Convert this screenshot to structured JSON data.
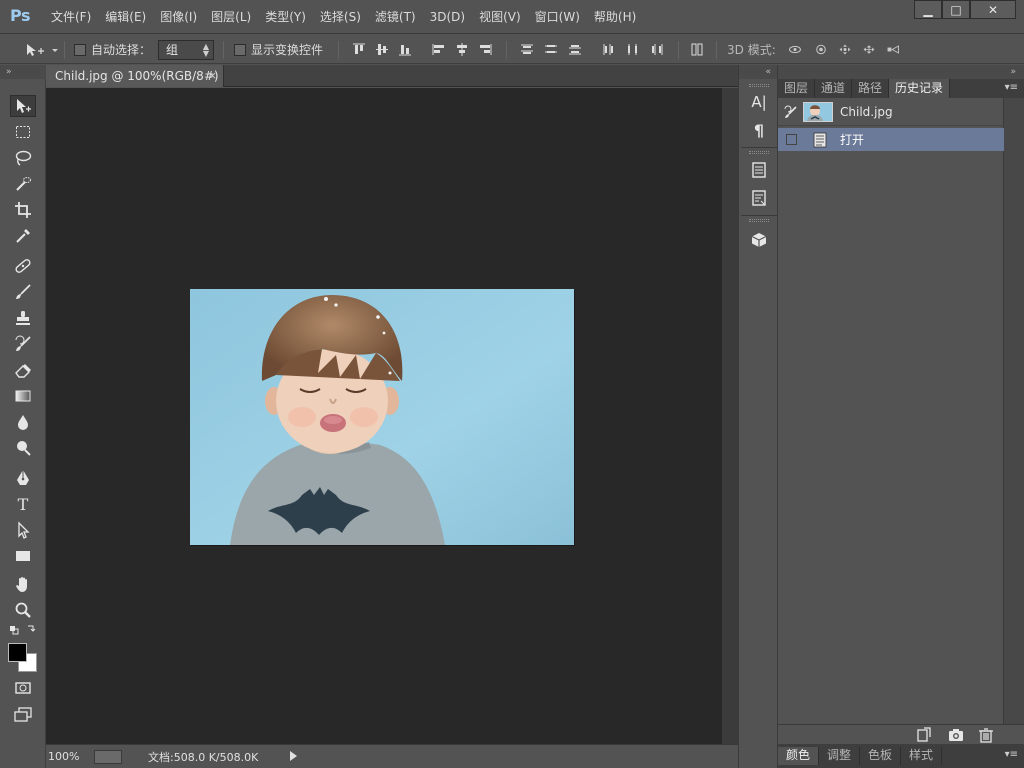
{
  "app": {
    "logo": "Ps",
    "menu": [
      "文件(F)",
      "编辑(E)",
      "图像(I)",
      "图层(L)",
      "类型(Y)",
      "选择(S)",
      "滤镜(T)",
      "3D(D)",
      "视图(V)",
      "窗口(W)",
      "帮助(H)"
    ],
    "window_controls": {
      "minimize": "▁",
      "maximize": "□",
      "close": "✕"
    }
  },
  "options_bar": {
    "auto_select_label": "自动选择：",
    "auto_select_target": "组",
    "show_transform_label": "显示变换控件",
    "mode_3d_label": "3D 模式:"
  },
  "document": {
    "tab_title": "Child.jpg @ 100%(RGB/8#)",
    "tab_close": "×"
  },
  "status": {
    "zoom": "100%",
    "doc_size": "文档:508.0 K/508.0K"
  },
  "panels": {
    "top_tabs": [
      "图层",
      "通道",
      "路径",
      "历史记录"
    ],
    "active_top_tab": 3,
    "history": {
      "snapshot_name": "Child.jpg",
      "states": [
        "打开"
      ]
    },
    "bottom_tabs": [
      "颜色",
      "调整",
      "色板",
      "样式"
    ],
    "active_bottom_tab": 0
  },
  "strip": {
    "character_icon": "A|",
    "paragraph_icon": "¶"
  },
  "colors": {
    "ui_bg": "#535353",
    "canvas_bg": "#282828",
    "selection": "#6b7a99",
    "logo": "#9ecbf0"
  }
}
